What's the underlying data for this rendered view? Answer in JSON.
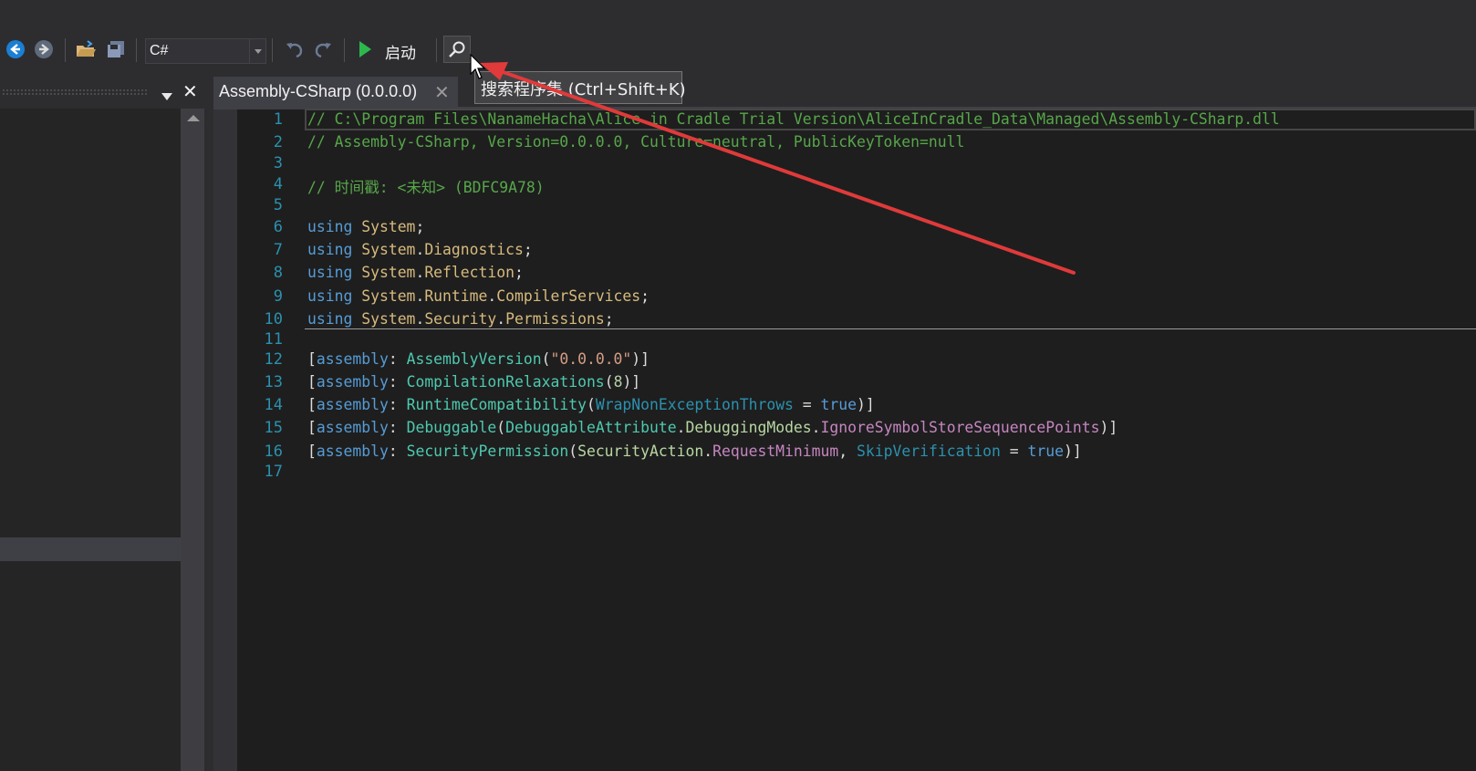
{
  "toolbar": {
    "language_value": "C#",
    "start_label": "启动",
    "icons": [
      "back-icon",
      "forward-icon",
      "open-folder-icon",
      "save-icon",
      "undo-icon",
      "redo-icon",
      "play-icon",
      "search-icon"
    ]
  },
  "tab": {
    "title": "Assembly-CSharp (0.0.0.0)",
    "close": "✕"
  },
  "tooltip": {
    "text": "搜索程序集 (Ctrl+Shift+K)"
  },
  "left_panel": {
    "close": "✕"
  },
  "editor": {
    "line_numbers": [
      "1",
      "2",
      "3",
      "4",
      "5",
      "6",
      "7",
      "8",
      "9",
      "10",
      "11",
      "12",
      "13",
      "14",
      "15",
      "16",
      "17"
    ],
    "lines": [
      [
        {
          "t": "// C:\\Program Files\\NanameHacha\\Alice in Cradle Trial Version\\AliceInCradle_Data\\Managed\\Assembly-CSharp.dll",
          "c": "comment"
        }
      ],
      [
        {
          "t": "// Assembly-CSharp, Version=0.0.0.0, Culture=neutral, PublicKeyToken=null",
          "c": "comment"
        }
      ],
      [],
      [
        {
          "t": "// 时间戳: <未知> (BDFC9A78)",
          "c": "comment"
        }
      ],
      [],
      [
        {
          "t": "using",
          "c": "kw"
        },
        {
          "t": " ",
          "c": "plain"
        },
        {
          "t": "System",
          "c": "ns"
        },
        {
          "t": ";",
          "c": "plain"
        }
      ],
      [
        {
          "t": "using",
          "c": "kw"
        },
        {
          "t": " ",
          "c": "plain"
        },
        {
          "t": "System",
          "c": "ns"
        },
        {
          "t": ".",
          "c": "plain"
        },
        {
          "t": "Diagnostics",
          "c": "ns"
        },
        {
          "t": ";",
          "c": "plain"
        }
      ],
      [
        {
          "t": "using",
          "c": "kw"
        },
        {
          "t": " ",
          "c": "plain"
        },
        {
          "t": "System",
          "c": "ns"
        },
        {
          "t": ".",
          "c": "plain"
        },
        {
          "t": "Reflection",
          "c": "ns"
        },
        {
          "t": ";",
          "c": "plain"
        }
      ],
      [
        {
          "t": "using",
          "c": "kw"
        },
        {
          "t": " ",
          "c": "plain"
        },
        {
          "t": "System",
          "c": "ns"
        },
        {
          "t": ".",
          "c": "plain"
        },
        {
          "t": "Runtime",
          "c": "ns"
        },
        {
          "t": ".",
          "c": "plain"
        },
        {
          "t": "CompilerServices",
          "c": "ns"
        },
        {
          "t": ";",
          "c": "plain"
        }
      ],
      [
        {
          "t": "using",
          "c": "kw"
        },
        {
          "t": " ",
          "c": "plain"
        },
        {
          "t": "System",
          "c": "ns"
        },
        {
          "t": ".",
          "c": "plain"
        },
        {
          "t": "Security",
          "c": "ns"
        },
        {
          "t": ".",
          "c": "plain"
        },
        {
          "t": "Permissions",
          "c": "ns"
        },
        {
          "t": ";",
          "c": "plain"
        }
      ],
      [],
      [
        {
          "t": "[",
          "c": "plain"
        },
        {
          "t": "assembly",
          "c": "kw"
        },
        {
          "t": ": ",
          "c": "plain"
        },
        {
          "t": "AssemblyVersion",
          "c": "type"
        },
        {
          "t": "(",
          "c": "plain"
        },
        {
          "t": "\"0.0.0.0\"",
          "c": "str"
        },
        {
          "t": ")]",
          "c": "plain"
        }
      ],
      [
        {
          "t": "[",
          "c": "plain"
        },
        {
          "t": "assembly",
          "c": "kw"
        },
        {
          "t": ": ",
          "c": "plain"
        },
        {
          "t": "CompilationRelaxations",
          "c": "type"
        },
        {
          "t": "(",
          "c": "plain"
        },
        {
          "t": "8",
          "c": "num"
        },
        {
          "t": ")]",
          "c": "plain"
        }
      ],
      [
        {
          "t": "[",
          "c": "plain"
        },
        {
          "t": "assembly",
          "c": "kw"
        },
        {
          "t": ": ",
          "c": "plain"
        },
        {
          "t": "RuntimeCompatibility",
          "c": "type"
        },
        {
          "t": "(",
          "c": "plain"
        },
        {
          "t": "WrapNonExceptionThrows",
          "c": "prop"
        },
        {
          "t": " = ",
          "c": "plain"
        },
        {
          "t": "true",
          "c": "kw"
        },
        {
          "t": ")]",
          "c": "plain"
        }
      ],
      [
        {
          "t": "[",
          "c": "plain"
        },
        {
          "t": "assembly",
          "c": "kw"
        },
        {
          "t": ": ",
          "c": "plain"
        },
        {
          "t": "Debuggable",
          "c": "type"
        },
        {
          "t": "(",
          "c": "plain"
        },
        {
          "t": "DebuggableAttribute",
          "c": "type"
        },
        {
          "t": ".",
          "c": "plain"
        },
        {
          "t": "DebuggingModes",
          "c": "enum"
        },
        {
          "t": ".",
          "c": "plain"
        },
        {
          "t": "IgnoreSymbolStoreSequencePoints",
          "c": "member"
        },
        {
          "t": ")]",
          "c": "plain"
        }
      ],
      [
        {
          "t": "[",
          "c": "plain"
        },
        {
          "t": "assembly",
          "c": "kw"
        },
        {
          "t": ": ",
          "c": "plain"
        },
        {
          "t": "SecurityPermission",
          "c": "type"
        },
        {
          "t": "(",
          "c": "plain"
        },
        {
          "t": "SecurityAction",
          "c": "enum"
        },
        {
          "t": ".",
          "c": "plain"
        },
        {
          "t": "RequestMinimum",
          "c": "member"
        },
        {
          "t": ", ",
          "c": "plain"
        },
        {
          "t": "SkipVerification",
          "c": "prop"
        },
        {
          "t": " = ",
          "c": "plain"
        },
        {
          "t": "true",
          "c": "kw"
        },
        {
          "t": ")]",
          "c": "plain"
        }
      ],
      []
    ]
  },
  "colors": {
    "background": "#2d2d30",
    "editor_bg": "#1e1e1e",
    "comment": "#57a64a",
    "keyword": "#569cd6",
    "annotation_arrow": "#e03a3a"
  }
}
